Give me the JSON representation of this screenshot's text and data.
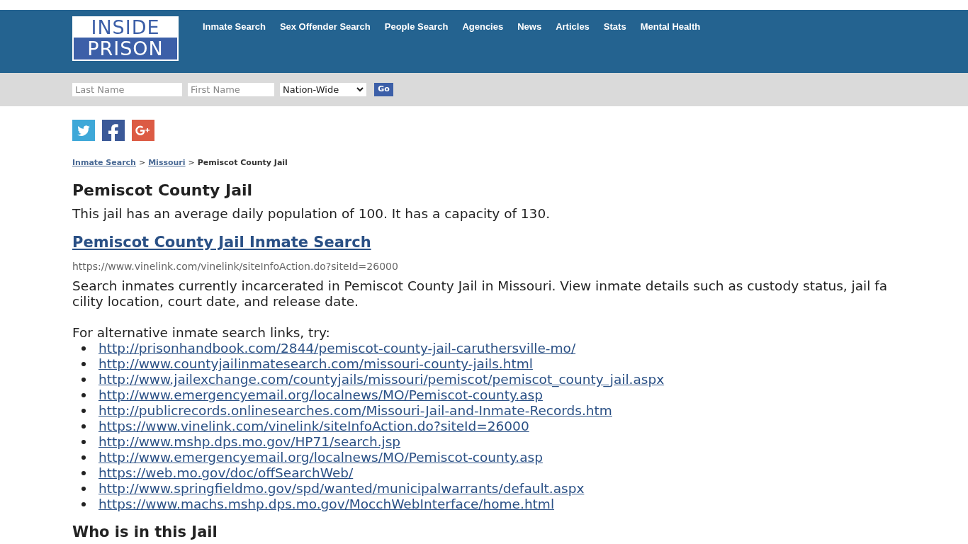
{
  "logo": {
    "line_1": "INSIDE",
    "line_2": "PRISON"
  },
  "nav": [
    "Inmate Search",
    "Sex Offender Search",
    "People Search",
    "Agencies",
    "News",
    "Articles",
    "Stats",
    "Mental Health"
  ],
  "search": {
    "last_name_placeholder": "Last Name",
    "first_name_placeholder": "First Name",
    "region": "Nation-Wide",
    "button": "Go"
  },
  "social": [
    {
      "kind": "twitter",
      "color": "#3ea8d8"
    },
    {
      "kind": "facebook",
      "color": "#3b5998"
    },
    {
      "kind": "googleplus",
      "color": "#dc5b44"
    }
  ],
  "breadcrumb": [
    {
      "label": "Inmate Search",
      "link": true
    },
    {
      "label": "Missouri",
      "link": true
    },
    {
      "label": "Pemiscot County Jail",
      "link": false
    }
  ],
  "breadcrumb_separator": ">",
  "title": "Pemiscot County Jail",
  "summary": "This jail has an average daily population of 100. It has a capacity of 130.",
  "result": {
    "title": "Pemiscot County Jail Inmate Search",
    "url": "https://www.vinelink.com/vinelink/siteInfoAction.do?siteId=26000",
    "description": "Search inmates currently incarcerated in Pemiscot County Jail in Missouri. View inmate details such as custody status, jail facility location, court date, and release date."
  },
  "alternatives_intro": "For alternative inmate search links, try:",
  "alternative_links": [
    "http://prisonhandbook.com/2844/pemiscot-county-jail-caruthersville-mo/",
    "http://www.countyjailinmatesearch.com/missouri-county-jails.html",
    "http://www.jailexchange.com/countyjails/missouri/pemiscot/pemiscot_county_jail.aspx",
    "http://www.emergencyemail.org/localnews/MO/Pemiscot-county.asp",
    "http://publicrecords.onlinesearches.com/Missouri-Jail-and-Inmate-Records.htm",
    "https://www.vinelink.com/vinelink/siteInfoAction.do?siteId=26000",
    "http://www.mshp.dps.mo.gov/HP71/search.jsp",
    "http://www.emergencyemail.org/localnews/MO/Pemiscot-county.asp",
    "https://web.mo.gov/doc/offSearchWeb/",
    "http://www.springfieldmo.gov/spd/wanted/municipalwarrants/default.aspx",
    "https://www.machs.mshp.dps.mo.gov/MocchWebInterface/home.html"
  ],
  "section_heading": "Who is in this Jail"
}
